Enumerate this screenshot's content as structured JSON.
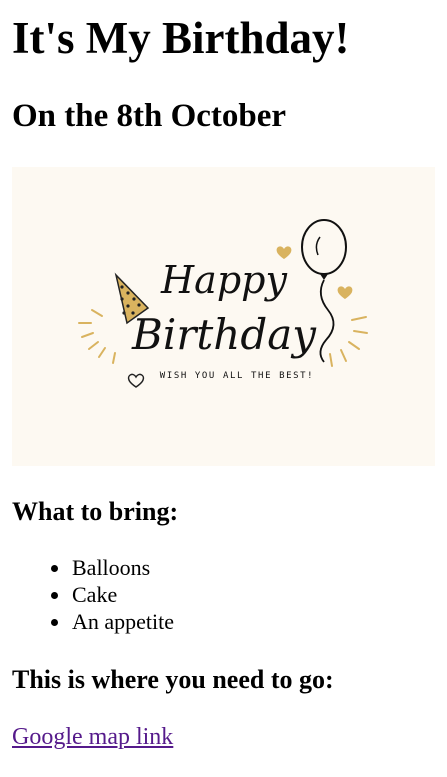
{
  "heading": "It's My Birthday!",
  "subheading": "On the 8th October",
  "card": {
    "line1": "Happy",
    "line2": "Birthday",
    "tagline": "WISH YOU ALL THE BEST!",
    "accent_color": "#d9b35f",
    "background": "#fdf9f2"
  },
  "bring": {
    "title": "What to bring:",
    "items": [
      "Balloons",
      "Cake",
      "An appetite"
    ]
  },
  "directions": {
    "title": "This is where you need to go:",
    "link_text": "Google map link",
    "link_color": "#551a8b"
  }
}
